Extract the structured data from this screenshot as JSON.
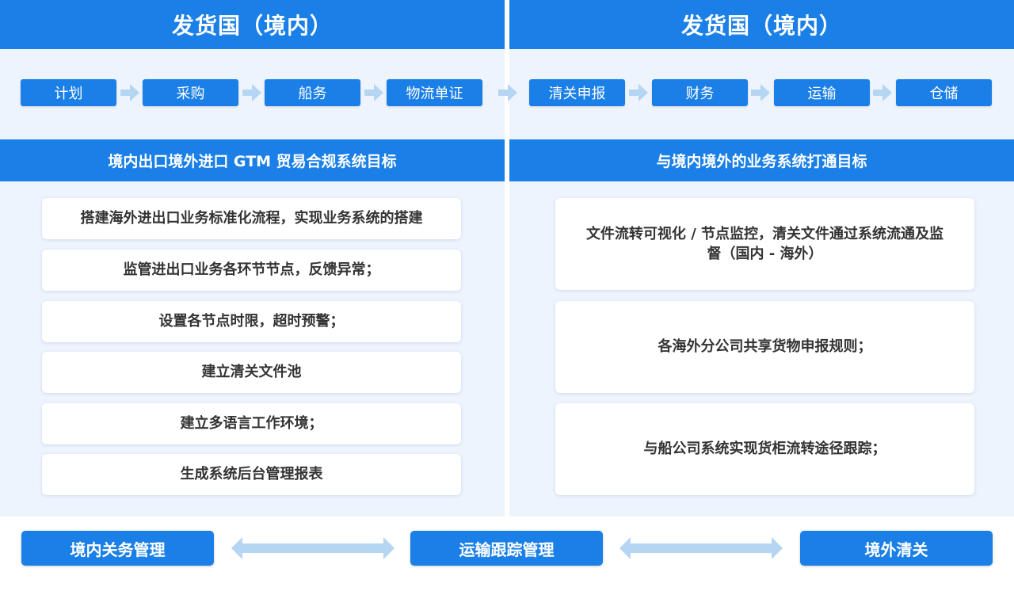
{
  "left": {
    "title": "发货国（境内）",
    "goal_header": "境内出口境外进口 GTM 贸易合规系统目标",
    "goals": [
      "搭建海外进出口业务标准化流程，实现业务系统的搭建",
      "监管进出口业务各环节节点，反馈异常；",
      "设置各节点时限，超时预警；",
      "建立清关文件池",
      "建立多语言工作环境；",
      "生成系统后台管理报表"
    ]
  },
  "right": {
    "title": "发货国（境内）",
    "goal_header": "与境内境外的业务系统打通目标",
    "goals": [
      "文件流转可视化 / 节点监控，清关文件通过系统流通及监督（国内 - 海外）",
      "各海外分公司共享货物申报规则；",
      "与船公司系统实现货柜流转途径跟踪；"
    ]
  },
  "flow_steps": [
    "计划",
    "采购",
    "船务",
    "物流单证",
    "清关申报",
    "财务",
    "运输",
    "仓储"
  ],
  "bottom": {
    "left": "境内关务管理",
    "center": "运输跟踪管理",
    "right": "境外清关"
  },
  "colors": {
    "primary": "#1a7fe6",
    "panel_bg": "#eef4fd",
    "arrow": "#b4d6f3"
  }
}
